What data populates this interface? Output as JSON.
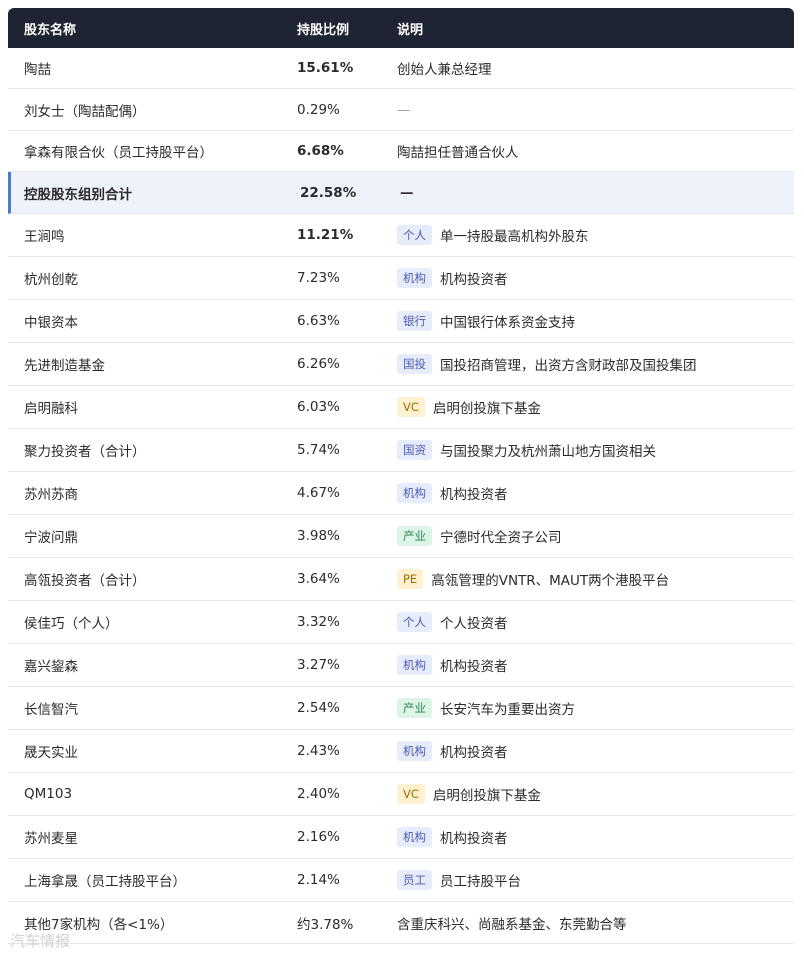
{
  "header": {
    "col1": "股东名称",
    "col2": "持股比例",
    "col3": "说明"
  },
  "rows": [
    {
      "name": "陶喆",
      "ratio": "15.61%",
      "ratio_bold": true,
      "tag": "",
      "tag_color": "",
      "desc": "创始人兼总经理"
    },
    {
      "name": "刘女士（陶喆配偶）",
      "ratio": "0.29%",
      "ratio_bold": false,
      "tag": "",
      "tag_color": "",
      "desc": "—"
    },
    {
      "name": "拿森有限合伙（员工持股平台）",
      "ratio": "6.68%",
      "ratio_bold": true,
      "tag": "",
      "tag_color": "",
      "desc": "陶喆担任普通合伙人"
    },
    {
      "name": "控股股东组别合计",
      "ratio": "22.58%",
      "ratio_bold": true,
      "tag": "",
      "tag_color": "",
      "desc": "—",
      "highlight": true
    },
    {
      "name": "王涧鸣",
      "ratio": "11.21%",
      "ratio_bold": true,
      "tag": "个人",
      "tag_color": "blue",
      "desc": "单一持股最高机构外股东"
    },
    {
      "name": "杭州创乾",
      "ratio": "7.23%",
      "ratio_bold": false,
      "tag": "机构",
      "tag_color": "blue",
      "desc": "机构投资者"
    },
    {
      "name": "中银资本",
      "ratio": "6.63%",
      "ratio_bold": false,
      "tag": "银行",
      "tag_color": "blue",
      "desc": "中国银行体系资金支持"
    },
    {
      "name": "先进制造基金",
      "ratio": "6.26%",
      "ratio_bold": false,
      "tag": "国投",
      "tag_color": "blue",
      "desc": "国投招商管理，出资方含财政部及国投集团"
    },
    {
      "name": "启明融科",
      "ratio": "6.03%",
      "ratio_bold": false,
      "tag": "VC",
      "tag_color": "yellow",
      "desc": "启明创投旗下基金"
    },
    {
      "name": "聚力投资者（合计）",
      "ratio": "5.74%",
      "ratio_bold": false,
      "tag": "国资",
      "tag_color": "blue",
      "desc": "与国投聚力及杭州萧山地方国资相关"
    },
    {
      "name": "苏州苏商",
      "ratio": "4.67%",
      "ratio_bold": false,
      "tag": "机构",
      "tag_color": "blue",
      "desc": "机构投资者"
    },
    {
      "name": "宁波问鼎",
      "ratio": "3.98%",
      "ratio_bold": false,
      "tag": "产业",
      "tag_color": "green",
      "desc": "宁德时代全资子公司"
    },
    {
      "name": "高瓴投资者（合计）",
      "ratio": "3.64%",
      "ratio_bold": false,
      "tag": "PE",
      "tag_color": "yellow",
      "desc": "高瓴管理的VNTR、MAUT两个港股平台"
    },
    {
      "name": "侯佳巧（个人）",
      "ratio": "3.32%",
      "ratio_bold": false,
      "tag": "个人",
      "tag_color": "blue",
      "desc": "个人投资者"
    },
    {
      "name": "嘉兴鋆森",
      "ratio": "3.27%",
      "ratio_bold": false,
      "tag": "机构",
      "tag_color": "blue",
      "desc": "机构投资者"
    },
    {
      "name": "长信智汽",
      "ratio": "2.54%",
      "ratio_bold": false,
      "tag": "产业",
      "tag_color": "green",
      "desc": "长安汽车为重要出资方"
    },
    {
      "name": "晟天实业",
      "ratio": "2.43%",
      "ratio_bold": false,
      "tag": "机构",
      "tag_color": "blue",
      "desc": "机构投资者"
    },
    {
      "name": "QM103",
      "ratio": "2.40%",
      "ratio_bold": false,
      "tag": "VC",
      "tag_color": "yellow",
      "desc": "启明创投旗下基金"
    },
    {
      "name": "苏州麦星",
      "ratio": "2.16%",
      "ratio_bold": false,
      "tag": "机构",
      "tag_color": "blue",
      "desc": "机构投资者"
    },
    {
      "name": "上海拿晟（员工持股平台）",
      "ratio": "2.14%",
      "ratio_bold": false,
      "tag": "员工",
      "tag_color": "blue",
      "desc": "员工持股平台"
    },
    {
      "name": "其他7家机构（各<1%）",
      "ratio": "约3.78%",
      "ratio_bold": false,
      "tag": "",
      "tag_color": "",
      "desc": "含重庆科兴、尚融系基金、东莞勤合等"
    }
  ],
  "watermark": "汽车情报"
}
